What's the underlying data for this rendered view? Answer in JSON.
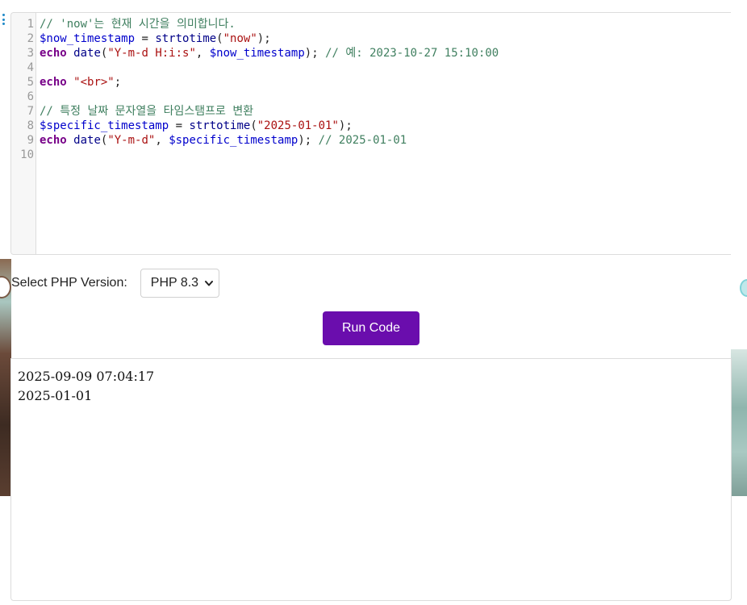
{
  "editor": {
    "line_numbers": [
      "1",
      "2",
      "3",
      "4",
      "5",
      "6",
      "7",
      "8",
      "9",
      "10"
    ],
    "lines": [
      [
        {
          "t": "// 'now'는 현재 시간을 의미합니다.",
          "c": "comment"
        }
      ],
      [
        {
          "t": "$now_timestamp",
          "c": "var"
        },
        {
          "t": " = ",
          "c": "punc"
        },
        {
          "t": "strtotime",
          "c": "fn"
        },
        {
          "t": "(",
          "c": "punc"
        },
        {
          "t": "\"now\"",
          "c": "str"
        },
        {
          "t": ");",
          "c": "punc"
        }
      ],
      [
        {
          "t": "echo",
          "c": "kw"
        },
        {
          "t": " ",
          "c": "punc"
        },
        {
          "t": "date",
          "c": "fn"
        },
        {
          "t": "(",
          "c": "punc"
        },
        {
          "t": "\"Y-m-d H:i:s\"",
          "c": "str"
        },
        {
          "t": ", ",
          "c": "punc"
        },
        {
          "t": "$now_timestamp",
          "c": "var"
        },
        {
          "t": "); ",
          "c": "punc"
        },
        {
          "t": "// 예: 2023-10-27 15:10:00",
          "c": "comment"
        }
      ],
      [],
      [
        {
          "t": "echo",
          "c": "kw"
        },
        {
          "t": " ",
          "c": "punc"
        },
        {
          "t": "\"<br>\"",
          "c": "str"
        },
        {
          "t": ";",
          "c": "punc"
        }
      ],
      [],
      [
        {
          "t": "// 특정 날짜 문자열을 타임스탬프로 변환",
          "c": "comment"
        }
      ],
      [
        {
          "t": "$specific_timestamp",
          "c": "var"
        },
        {
          "t": " = ",
          "c": "punc"
        },
        {
          "t": "strtotime",
          "c": "fn"
        },
        {
          "t": "(",
          "c": "punc"
        },
        {
          "t": "\"2025-01-01\"",
          "c": "str"
        },
        {
          "t": ");",
          "c": "punc"
        }
      ],
      [
        {
          "t": "echo",
          "c": "kw"
        },
        {
          "t": " ",
          "c": "punc"
        },
        {
          "t": "date",
          "c": "fn"
        },
        {
          "t": "(",
          "c": "punc"
        },
        {
          "t": "\"Y-m-d\"",
          "c": "str"
        },
        {
          "t": ", ",
          "c": "punc"
        },
        {
          "t": "$specific_timestamp",
          "c": "var"
        },
        {
          "t": "); ",
          "c": "punc"
        },
        {
          "t": "// 2025-01-01",
          "c": "comment"
        }
      ],
      []
    ]
  },
  "controls": {
    "version_label": "Select PHP Version:",
    "version_selected": "PHP 8.3",
    "run_label": "Run Code"
  },
  "output": {
    "lines": [
      "2025-09-09 07:04:17",
      "2025-01-01"
    ]
  },
  "colors": {
    "run_button": "#6a0dad",
    "comment": "#3f7f5f",
    "keyword": "#770088",
    "variable": "#0000cc",
    "string": "#aa1111"
  },
  "icons": {
    "drag_handle": "vertical-dots-icon",
    "select_arrow": "chevron-down-icon"
  }
}
